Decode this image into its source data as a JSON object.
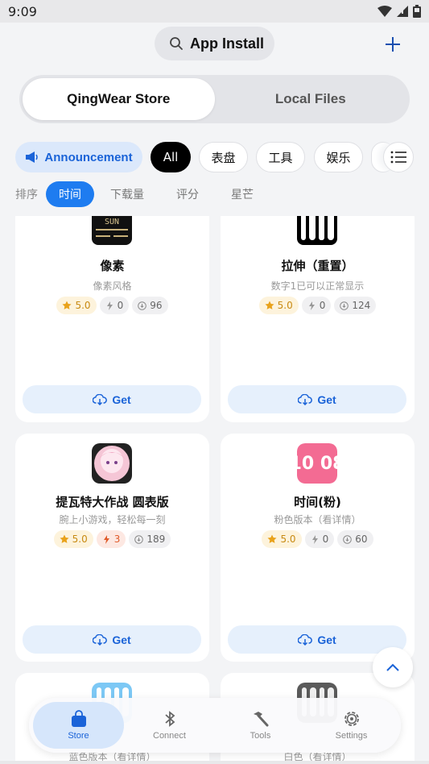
{
  "status_bar": {
    "time": "9:09"
  },
  "header": {
    "title": "App Install"
  },
  "segments": [
    "QingWear Store",
    "Local Files"
  ],
  "chips": {
    "announcement": "Announcement",
    "categories": [
      "All",
      "表盘",
      "工具",
      "娱乐"
    ]
  },
  "sort": {
    "label": "排序",
    "options": [
      "时间",
      "下载量",
      "评分",
      "星芒"
    ]
  },
  "cards": [
    {
      "name": "像素",
      "desc": "像素风格",
      "rating": "5.0",
      "stars": "0",
      "downloads": "96",
      "get": "Get"
    },
    {
      "name": "拉伸（重置）",
      "desc": "数字1已可以正常显示",
      "rating": "5.0",
      "stars": "0",
      "downloads": "124",
      "get": "Get"
    },
    {
      "name": "提瓦特大作战 圆表版",
      "desc": "腕上小游戏，轻松每一刻",
      "rating": "5.0",
      "stars": "3",
      "downloads": "189",
      "get": "Get"
    },
    {
      "name": "时间(粉)",
      "desc": "粉色版本（看详情）",
      "rating": "5.0",
      "stars": "0",
      "downloads": "60",
      "get": "Get"
    },
    {
      "desc": "蓝色版本（看详情）"
    },
    {
      "desc": "白色（看详情）"
    }
  ],
  "thumb_text": {
    "pixel": "SUN",
    "pink_time": "10 08"
  },
  "nav": [
    {
      "label": "Store",
      "icon": "bag-icon"
    },
    {
      "label": "Connect",
      "icon": "bluetooth-icon"
    },
    {
      "label": "Tools",
      "icon": "hammer-icon"
    },
    {
      "label": "Settings",
      "icon": "gear-icon"
    }
  ],
  "colors": {
    "accent": "#1e7cf0",
    "star": "#e9a21a",
    "bolt_hot": "#e05a2a"
  }
}
